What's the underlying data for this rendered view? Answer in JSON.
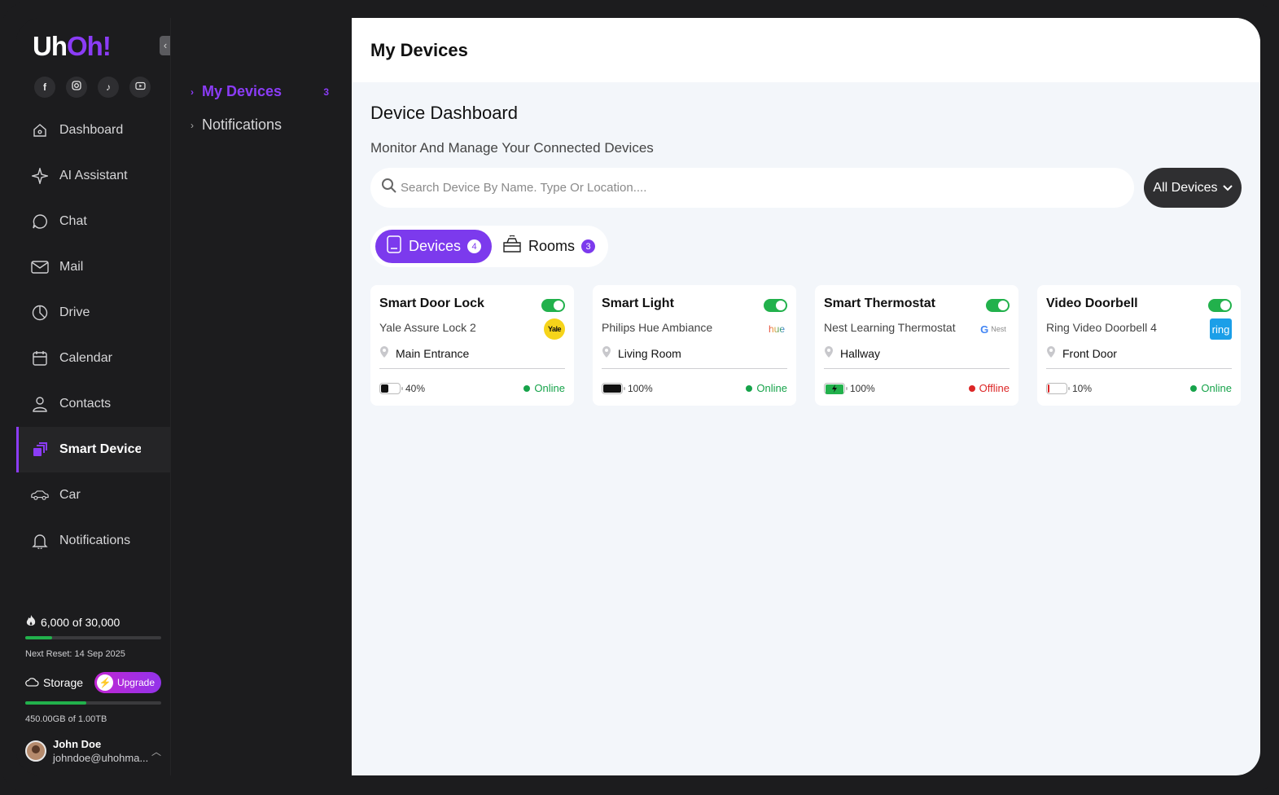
{
  "brand": {
    "logo_a": "Uh",
    "logo_b": "Oh!"
  },
  "socials": [
    "facebook-icon",
    "instagram-icon",
    "tiktok-icon",
    "youtube-icon"
  ],
  "sidebar": {
    "items": [
      {
        "label": "Dashboard",
        "icon": "home-icon"
      },
      {
        "label": "AI Assistant",
        "icon": "sparkle-icon"
      },
      {
        "label": "Chat",
        "icon": "chat-icon"
      },
      {
        "label": "Mail",
        "icon": "mail-icon"
      },
      {
        "label": "Drive",
        "icon": "pie-chart-icon"
      },
      {
        "label": "Calendar",
        "icon": "calendar-icon"
      },
      {
        "label": "Contacts",
        "icon": "user-icon"
      },
      {
        "label": "Smart Devices",
        "icon": "devices-icon",
        "active": true
      },
      {
        "label": "Car",
        "icon": "car-icon"
      },
      {
        "label": "Notifications",
        "icon": "bell-icon"
      }
    ]
  },
  "usage": {
    "text": "6,000 of 30,000",
    "fraction": 0.2,
    "reset": "Next Reset: 14 Sep 2025"
  },
  "storage": {
    "label": "Storage",
    "upgrade": "Upgrade",
    "fraction": 0.45,
    "text": "450.00GB of 1.00TB"
  },
  "user": {
    "name": "John Doe",
    "email": "johndoe@uhohma..."
  },
  "subnav": {
    "items": [
      {
        "label": "My Devices",
        "count": "3",
        "active": true
      },
      {
        "label": "Notifications",
        "count": ""
      }
    ]
  },
  "header": {
    "title": "My Devices"
  },
  "dashboard": {
    "title": "Device Dashboard",
    "subtitle": "Monitor And Manage Your Connected Devices",
    "search_placeholder": "Search Device By Name. Type Or Location....",
    "filter_label": "All Devices"
  },
  "tabs": [
    {
      "label": "Devices",
      "count": "4",
      "active": true
    },
    {
      "label": "Rooms",
      "count": "3"
    }
  ],
  "devices": [
    {
      "name": "Smart Door Lock",
      "model": "Yale Assure Lock 2",
      "brand": "Yale",
      "location": "Main Entrance",
      "battery": "40%",
      "battery_level": 0.4,
      "status": "Online",
      "status_color": "#16a34a",
      "battery_color": "#111111"
    },
    {
      "name": "Smart Light",
      "model": "Philips Hue Ambiance",
      "brand": "hue",
      "location": "Living Room",
      "battery": "100%",
      "battery_level": 1.0,
      "status": "Online",
      "status_color": "#16a34a",
      "battery_color": "#111111"
    },
    {
      "name": "Smart Thermostat",
      "model": "Nest Learning Thermostat",
      "brand": "Nest",
      "location": "Hallway",
      "battery": "100%",
      "battery_level": 1.0,
      "status": "Offline",
      "status_color": "#dc2626",
      "battery_color": "#22b14c"
    },
    {
      "name": "Video Doorbell",
      "model": "Ring Video Doorbell 4",
      "brand": "ring",
      "location": "Front Door",
      "battery": "10%",
      "battery_level": 0.1,
      "status": "Online",
      "status_color": "#16a34a",
      "battery_color": "#dc2626"
    }
  ]
}
